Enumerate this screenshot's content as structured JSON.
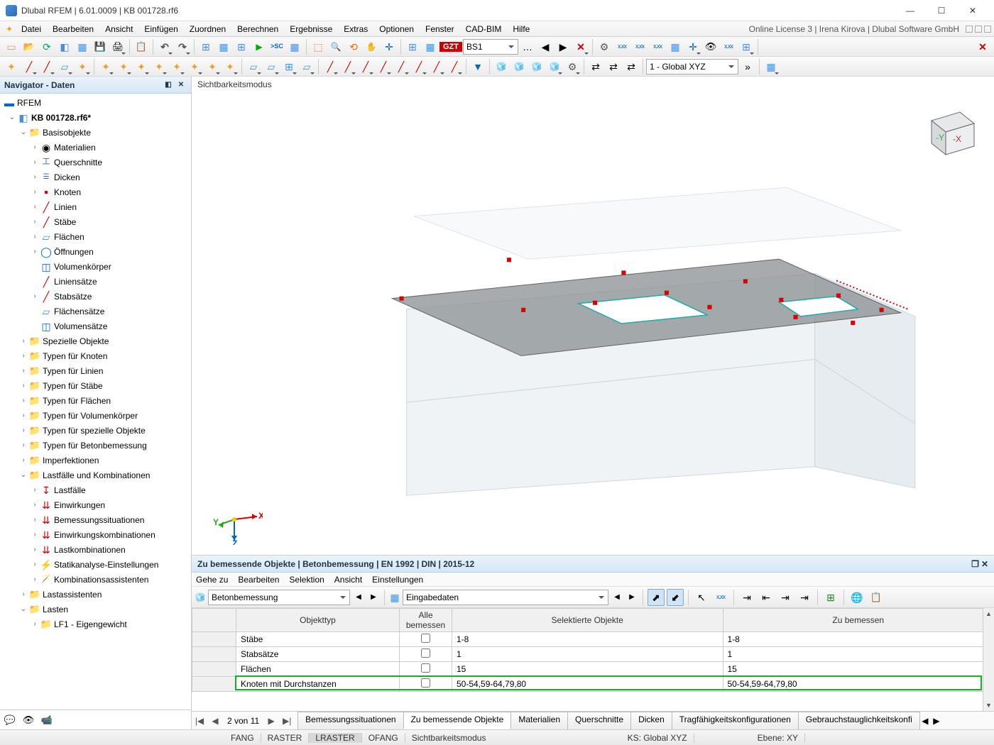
{
  "title": "Dlubal RFEM | 6.01.0009 | KB  001728.rf6",
  "license_info": "Online License 3 | Irena Kirova | Dlubal Software GmbH",
  "menu": [
    "Datei",
    "Bearbeiten",
    "Ansicht",
    "Einfügen",
    "Zuordnen",
    "Berechnen",
    "Ergebnisse",
    "Extras",
    "Optionen",
    "Fenster",
    "CAD-BIM",
    "Hilfe"
  ],
  "toolbar1": {
    "gzt_label": "GZT",
    "combo1_value": "BS1",
    "coord_combo": "1 - Global XYZ"
  },
  "navigator": {
    "title": "Navigator - Daten",
    "root": "RFEM",
    "file": "KB 001728.rf6*",
    "groups": {
      "basisobjekte": {
        "label": "Basisobjekte",
        "children": [
          "Materialien",
          "Querschnitte",
          "Dicken",
          "Knoten",
          "Linien",
          "Stäbe",
          "Flächen",
          "Öffnungen",
          "Volumenkörper",
          "Liniensätze",
          "Stabsätze",
          "Flächensätze",
          "Volumensätze"
        ]
      },
      "others": [
        "Spezielle Objekte",
        "Typen für Knoten",
        "Typen für Linien",
        "Typen für Stäbe",
        "Typen für Flächen",
        "Typen für Volumenkörper",
        "Typen für spezielle Objekte",
        "Typen für Betonbemessung",
        "Imperfektionen"
      ],
      "lastfaelle": {
        "label": "Lastfälle und Kombinationen",
        "children": [
          "Lastfälle",
          "Einwirkungen",
          "Bemessungssituationen",
          "Einwirkungskombinationen",
          "Lastkombinationen",
          "Statikanalyse-Einstellungen",
          "Kombinationsassistenten"
        ]
      },
      "others2": [
        "Lastassistenten"
      ],
      "lasten": {
        "label": "Lasten",
        "children": [
          "LF1 - Eigengewicht"
        ]
      }
    }
  },
  "viewport": {
    "mode_label": "Sichtbarkeitsmodus",
    "axis_labels": {
      "x": "X",
      "y": "Y",
      "z": "Z"
    }
  },
  "bottom": {
    "title": "Zu bemessende Objekte | Betonbemessung | EN 1992 | DIN | 2015-12",
    "menu": [
      "Gehe zu",
      "Bearbeiten",
      "Selektion",
      "Ansicht",
      "Einstellungen"
    ],
    "combo_design": "Betonbemessung",
    "combo_input": "Eingabedaten",
    "headers": {
      "type": "Objekttyp",
      "all": "Alle bemessen",
      "selected": "Selektierte Objekte",
      "to_design": "Zu bemessen"
    },
    "rows": [
      {
        "type": "Stäbe",
        "all": false,
        "sel": "1-8",
        "des": "1-8"
      },
      {
        "type": "Stabsätze",
        "all": false,
        "sel": "1",
        "des": "1"
      },
      {
        "type": "Flächen",
        "all": false,
        "sel": "15",
        "des": "15"
      },
      {
        "type": "Knoten mit Durchstanzen",
        "all": false,
        "sel": "50-54,59-64,79,80",
        "des": "50-54,59-64,79,80"
      }
    ],
    "pager": {
      "pos": "2 von 11"
    },
    "tabs": [
      "Bemessungssituationen",
      "Zu bemessende Objekte",
      "Materialien",
      "Querschnitte",
      "Dicken",
      "Tragfähigkeitskonfigurationen",
      "Gebrauchstauglichkeitskonfi"
    ],
    "active_tab": 1
  },
  "status": {
    "items": [
      "FANG",
      "RASTER",
      "LRASTER",
      "OFANG",
      "Sichtbarkeitsmodus"
    ],
    "on_index": 2,
    "ks": "KS: Global XYZ",
    "ebene": "Ebene: XY"
  }
}
